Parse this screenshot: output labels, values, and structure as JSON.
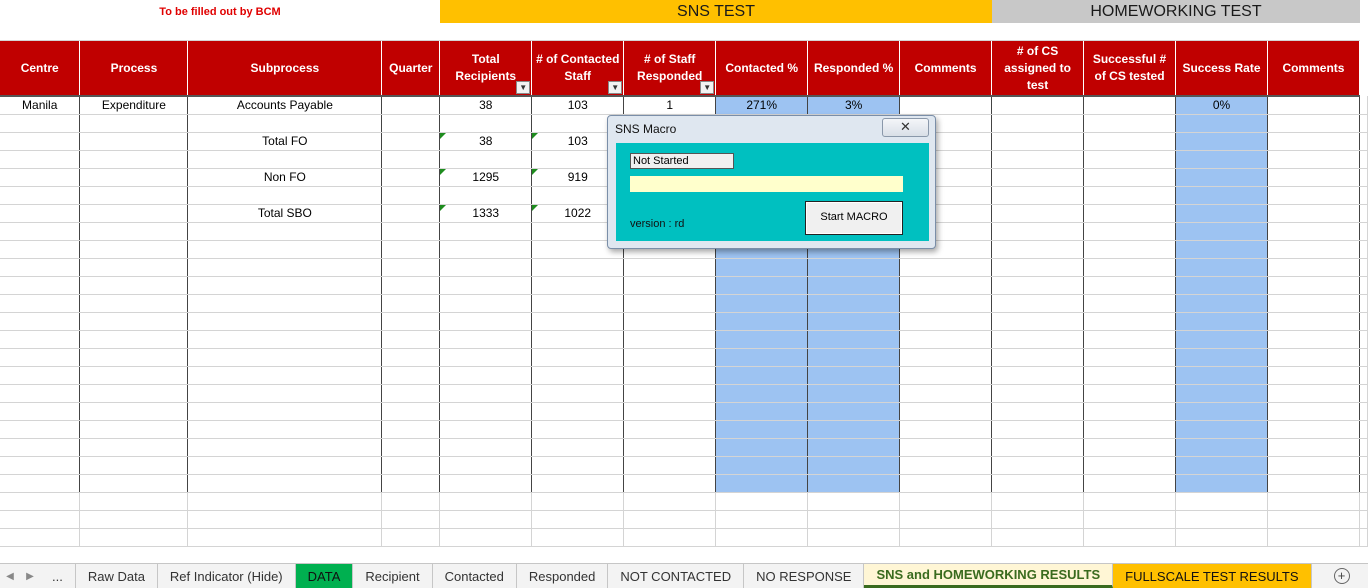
{
  "top_note": "To be filled out by BCM",
  "sns_band": "SNS TEST",
  "homeworking_band": "HOMEWORKING TEST",
  "headers": [
    "Centre",
    "Process",
    "Subprocess",
    "Quarter",
    "Total Recipients",
    "# of Contacted Staff",
    "# of Staff Responded",
    "Contacted %",
    "Responded %",
    "Comments",
    "# of CS assigned to test",
    "Successful # of CS tested",
    "Success Rate",
    "Comments"
  ],
  "rows": [
    [
      "Manila",
      "Expenditure",
      "Accounts Payable",
      "",
      "38",
      "103",
      "1",
      "271%",
      "3%",
      "",
      "",
      "",
      "0%",
      ""
    ],
    [
      "",
      "",
      "",
      "",
      "",
      "",
      "",
      "",
      "",
      "",
      "",
      "",
      "",
      ""
    ],
    [
      "",
      "",
      "Total FO",
      "",
      "38",
      "103",
      "",
      "",
      "",
      "",
      "",
      "",
      "",
      ""
    ],
    [
      "",
      "",
      "",
      "",
      "",
      "",
      "",
      "",
      "",
      "",
      "",
      "",
      "",
      ""
    ],
    [
      "",
      "",
      "Non FO",
      "",
      "1295",
      "919",
      "",
      "",
      "",
      "",
      "",
      "",
      "",
      ""
    ],
    [
      "",
      "",
      "",
      "",
      "",
      "",
      "",
      "",
      "",
      "",
      "",
      "",
      "",
      ""
    ],
    [
      "",
      "",
      "Total SBO",
      "",
      "1333",
      "1022",
      "",
      "",
      "",
      "",
      "",
      "",
      "",
      ""
    ]
  ],
  "dialog": {
    "title": "SNS Macro",
    "close_glyph": "✕",
    "status": "Not Started",
    "version": "version : rd",
    "start_button": "Start MACRO"
  },
  "tabs": [
    "...",
    "Raw Data",
    "Ref Indicator (Hide)",
    "DATA",
    "Recipient",
    "Contacted",
    "Responded",
    "NOT CONTACTED",
    "NO RESPONSE",
    "SNS and HOMEWORKING RESULTS",
    "FULLSCALE TEST RESULTS"
  ],
  "colors": {
    "header_red": "#c00000",
    "sns_yellow": "#ffc000",
    "homeworking_grey": "#c8c8c8",
    "highlight_blue": "#9dc3f2",
    "macro_teal": "#00c0c0",
    "tab_green": "#00b050",
    "tab_yellow": "#ffc000"
  }
}
